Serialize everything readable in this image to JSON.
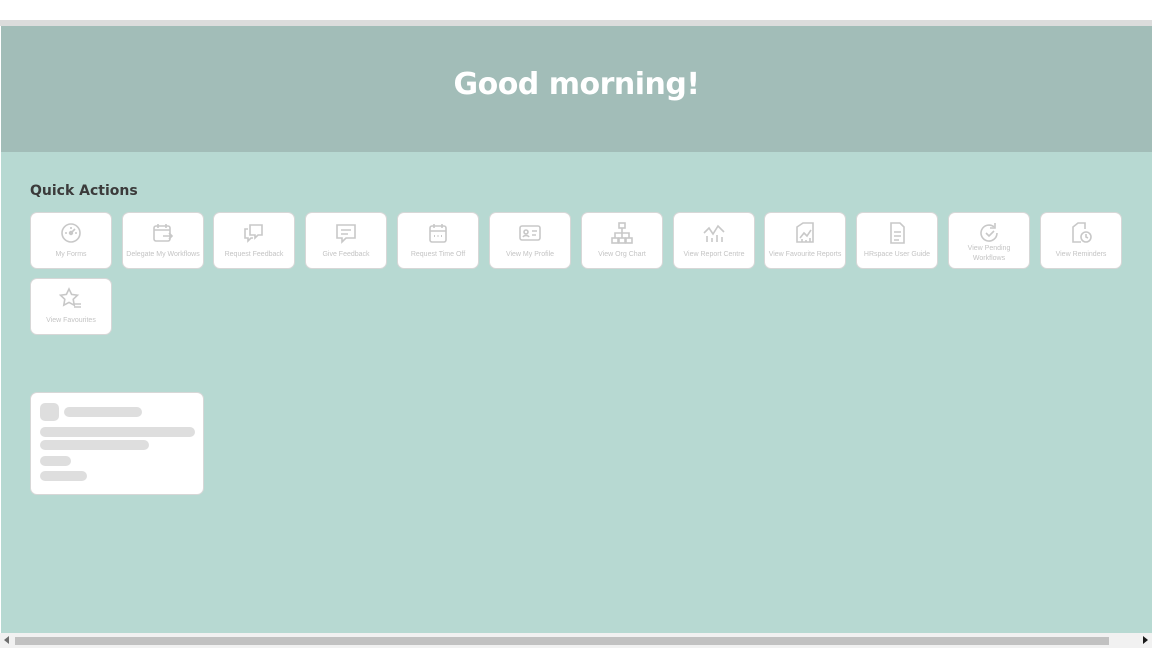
{
  "greeting": "Good morning!",
  "quick_actions": {
    "title": "Quick Actions",
    "items": [
      {
        "label": "My Forms",
        "icon": "gauge-icon"
      },
      {
        "label": "Delegate My Workflows",
        "icon": "calendar-arrow-icon"
      },
      {
        "label": "Request Feedback",
        "icon": "chat-bubbles-icon"
      },
      {
        "label": "Give Feedback",
        "icon": "comment-icon"
      },
      {
        "label": "Request Time Off",
        "icon": "calendar-icon"
      },
      {
        "label": "View My Profile",
        "icon": "id-card-icon"
      },
      {
        "label": "View Org Chart",
        "icon": "org-chart-icon"
      },
      {
        "label": "View Report Centre",
        "icon": "line-chart-icon"
      },
      {
        "label": "View Favourite Reports",
        "icon": "report-chart-icon"
      },
      {
        "label": "HRspace User Guide",
        "icon": "document-icon"
      },
      {
        "label": "View Pending Workflows",
        "icon": "refresh-icon"
      },
      {
        "label": "View Reminders",
        "icon": "reminder-icon"
      },
      {
        "label": "View Favourites",
        "icon": "star-list-icon"
      }
    ]
  },
  "colors": {
    "hero_bg": "#a2bdb8",
    "page_bg": "#b7d9d2",
    "tile_icon": "#c8c8c8",
    "skeleton": "#dedede"
  }
}
